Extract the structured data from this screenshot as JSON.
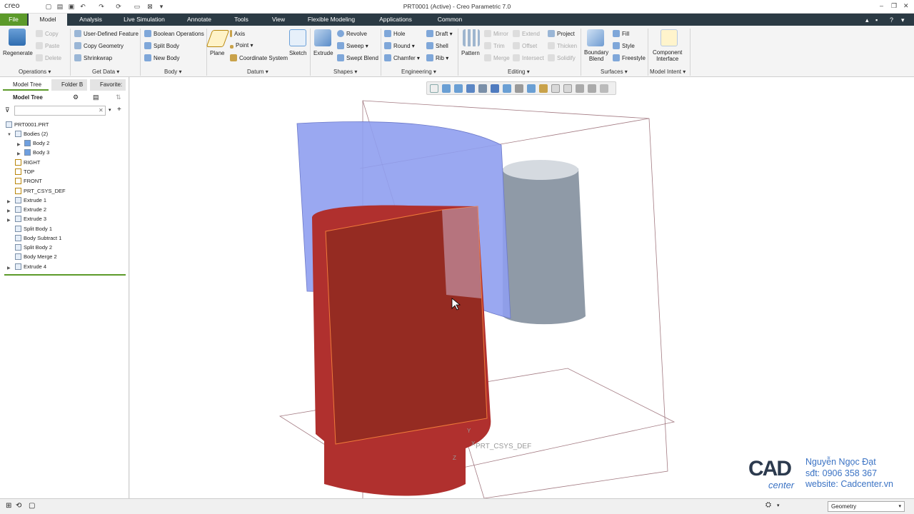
{
  "titlebar": {
    "logo": "creo",
    "title": "PRT0001 (Active) - Creo Parametric 7.0"
  },
  "menu": [
    "File",
    "Model",
    "Analysis",
    "Live Simulation",
    "Annotate",
    "Tools",
    "View",
    "Flexible Modeling",
    "Applications",
    "Common"
  ],
  "ribbon": {
    "operations": {
      "regenerate": "Regenerate",
      "copy": "Copy",
      "paste": "Paste",
      "delete": "Delete",
      "group": "Operations"
    },
    "getdata": {
      "udf": "User-Defined Feature",
      "copygeom": "Copy Geometry",
      "shrinkwrap": "Shrinkwrap",
      "group": "Get Data"
    },
    "body": {
      "boolean": "Boolean Operations",
      "split": "Split Body",
      "new": "New Body",
      "group": "Body"
    },
    "datum": {
      "plane": "Plane",
      "axis": "Axis",
      "point": "Point",
      "csys": "Coordinate System",
      "sketch": "Sketch",
      "group": "Datum"
    },
    "shapes": {
      "extrude": "Extrude",
      "revolve": "Revolve",
      "sweep": "Sweep",
      "sweptblend": "Swept Blend",
      "group": "Shapes"
    },
    "engineering": {
      "hole": "Hole",
      "round": "Round",
      "chamfer": "Chamfer",
      "draft": "Draft",
      "shell": "Shell",
      "rib": "Rib",
      "group": "Engineering"
    },
    "editing": {
      "pattern": "Pattern",
      "mirror": "Mirror",
      "trim": "Trim",
      "merge": "Merge",
      "extend": "Extend",
      "offset": "Offset",
      "intersect": "Intersect",
      "project": "Project",
      "thicken": "Thicken",
      "solidify": "Solidify",
      "group": "Editing"
    },
    "surfaces": {
      "boundary1": "Boundary",
      "boundary2": "Blend",
      "fill": "Fill",
      "style": "Style",
      "freestyle": "Freestyle",
      "group": "Surfaces"
    },
    "modelintent": {
      "component1": "Component",
      "component2": "Interface",
      "group": "Model Intent"
    }
  },
  "sidebar": {
    "tabs": [
      "Model Tree",
      "Folder B",
      "Favorite:"
    ],
    "header": "Model Tree",
    "search_placeholder": "",
    "tree": [
      "PRT0001.PRT",
      "Bodies (2)",
      "Body 2",
      "Body 3",
      "RIGHT",
      "TOP",
      "FRONT",
      "PRT_CSYS_DEF",
      "Extrude 1",
      "Extrude 2",
      "Extrude 3",
      "Split Body 1",
      "Body Subtract 1",
      "Split Body 2",
      "Body Merge 2",
      "Extrude 4"
    ]
  },
  "viewport": {
    "csys_label": "PRT_CSYS_DEF",
    "axis_x": "X",
    "axis_y": "Y",
    "axis_z": "Z"
  },
  "watermark": {
    "logo_main": "CAD",
    "logo_sub": "center",
    "name": "Nguyễn Ngọc Đạt",
    "phone": "sđt: 0906 358 367",
    "website": "website: Cadcenter.vn"
  },
  "statusbar": {
    "filter": "Geometry"
  },
  "colors": {
    "menubar": "#2b3a44",
    "file_tab": "#5c9a2a",
    "red_body": "#b0302e",
    "blue_surface": "#8f9ef0",
    "gray_cylinder": "#8f9aa7"
  }
}
